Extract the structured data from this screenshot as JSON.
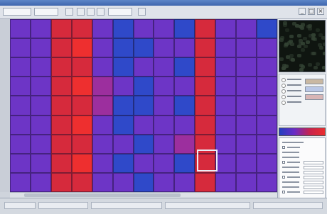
{
  "window": {
    "title": ""
  },
  "toolbar": {
    "minimize_label": "_",
    "maximize_label": "□",
    "close_label": "×"
  },
  "heatmap": {
    "rows": 9,
    "cols": 13,
    "selected_cell": {
      "row": 7,
      "col": 9
    },
    "colors": {
      "blue": "#2f49c9",
      "violet": "#6d35c6",
      "magenta": "#9c2f9e",
      "red": "#d62a3c",
      "bright_red": "#ee2f2f"
    },
    "grid": [
      [
        "violet",
        "violet",
        "red",
        "red",
        "violet",
        "blue",
        "violet",
        "violet",
        "blue",
        "red",
        "violet",
        "violet",
        "blue"
      ],
      [
        "violet",
        "violet",
        "red",
        "bright_red",
        "violet",
        "blue",
        "blue",
        "violet",
        "violet",
        "red",
        "violet",
        "violet",
        "violet"
      ],
      [
        "violet",
        "violet",
        "red",
        "red",
        "violet",
        "blue",
        "violet",
        "violet",
        "blue",
        "red",
        "violet",
        "violet",
        "violet"
      ],
      [
        "violet",
        "violet",
        "red",
        "bright_red",
        "magenta",
        "violet",
        "blue",
        "violet",
        "violet",
        "red",
        "violet",
        "violet",
        "violet"
      ],
      [
        "violet",
        "violet",
        "red",
        "red",
        "magenta",
        "blue",
        "blue",
        "violet",
        "blue",
        "red",
        "violet",
        "violet",
        "violet"
      ],
      [
        "violet",
        "violet",
        "red",
        "bright_red",
        "violet",
        "blue",
        "violet",
        "violet",
        "violet",
        "red",
        "violet",
        "violet",
        "violet"
      ],
      [
        "violet",
        "violet",
        "red",
        "red",
        "violet",
        "violet",
        "blue",
        "violet",
        "magenta",
        "red",
        "violet",
        "violet",
        "violet"
      ],
      [
        "violet",
        "violet",
        "red",
        "bright_red",
        "violet",
        "blue",
        "violet",
        "violet",
        "blue",
        "red",
        "violet",
        "violet",
        "violet"
      ],
      [
        "violet",
        "violet",
        "red",
        "red",
        "violet",
        "violet",
        "blue",
        "violet",
        "violet",
        "red",
        "violet",
        "violet",
        "violet"
      ]
    ]
  },
  "side_panel": {
    "legend_colors": [
      "#c9b8a2",
      "#b9c7e6",
      "#d8b5b5"
    ],
    "colorbar_colors": [
      "#223ebf",
      "#6a2bc6",
      "#c7234e",
      "#ea2d2d"
    ]
  },
  "status": {}
}
